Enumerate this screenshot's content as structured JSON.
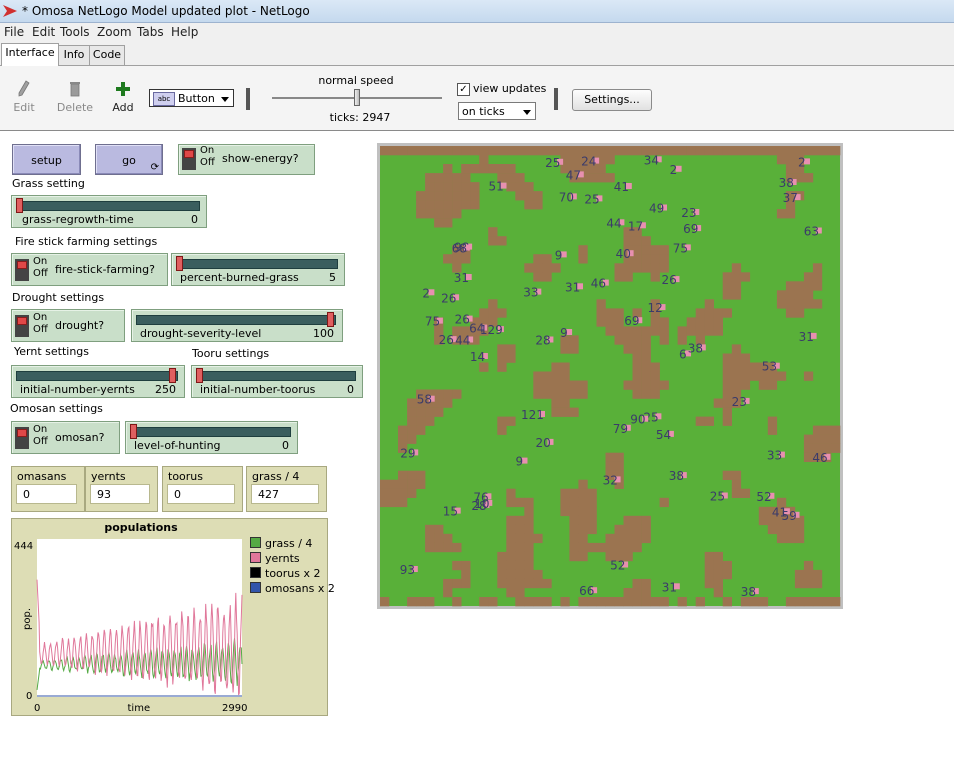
{
  "window": {
    "title": "* Omosa NetLogo Model updated plot - NetLogo"
  },
  "menu": [
    "File",
    "Edit",
    "Tools",
    "Zoom",
    "Tabs",
    "Help"
  ],
  "tabs": [
    "Interface",
    "Info",
    "Code"
  ],
  "toolbar": {
    "edit": "Edit",
    "delete": "Delete",
    "add": "Add",
    "widget_type": "Button",
    "widget_icon": "abc",
    "speed_label": "normal speed",
    "speed_fraction": 0.5,
    "ticks": "ticks: 2947",
    "view_updates": "view updates",
    "view_updates_checked": true,
    "update_mode": "on ticks",
    "settings": "Settings..."
  },
  "buttons": {
    "setup": "setup",
    "go": "go"
  },
  "switch_text": {
    "on": "On",
    "off": "Off"
  },
  "notes": {
    "grass": "Grass setting",
    "fire": "Fire stick farming settings",
    "drought": "Drought settings",
    "yernt": "Yernt settings",
    "tooru": "Tooru settings",
    "omosan": "Omosan settings"
  },
  "switches": {
    "show_energy": "show-energy?",
    "fire_stick": "fire-stick-farming?",
    "drought": "drought?",
    "omosan": "omosan?"
  },
  "sliders": {
    "grass_regrowth": {
      "label": "grass-regrowth-time",
      "value": "0",
      "fraction": 0.0
    },
    "percent_burned": {
      "label": "percent-burned-grass",
      "value": "5",
      "fraction": 0.0
    },
    "drought_severity": {
      "label": "drought-severity-level",
      "value": "100",
      "fraction": 1.0
    },
    "yernts": {
      "label": "initial-number-yernts",
      "value": "250",
      "fraction": 1.0
    },
    "toorus": {
      "label": "initial-number-toorus",
      "value": "0",
      "fraction": 0.0
    },
    "hunting": {
      "label": "level-of-hunting",
      "value": "0",
      "fraction": 0.0
    }
  },
  "monitors": [
    {
      "label": "omasans",
      "value": "0"
    },
    {
      "label": "yernts",
      "value": "93"
    },
    {
      "label": "toorus",
      "value": "0"
    },
    {
      "label": "grass / 4",
      "value": "427"
    }
  ],
  "chart_data": {
    "type": "line",
    "title": "populations",
    "xlabel": "time",
    "ylabel": "pop.",
    "xlim": [
      0,
      2990
    ],
    "ylim": [
      0,
      444
    ],
    "x_ticks": [
      "0",
      "2990"
    ],
    "y_ticks": [
      "444",
      "0"
    ],
    "legend_placement": "right",
    "series": [
      {
        "name": "grass / 4",
        "color": "#55aa44"
      },
      {
        "name": "yernts",
        "color": "#e0779a"
      },
      {
        "name": "toorus x 2",
        "color": "#000000"
      },
      {
        "name": "omosans x 2",
        "color": "#3355aa"
      }
    ]
  },
  "world": {
    "grass_color": "#59b039",
    "dirt_color": "#9b7450",
    "labels": [
      "70",
      "15",
      "79",
      "63",
      "46",
      "25",
      "28",
      "37",
      "12",
      "31",
      "23",
      "9",
      "2",
      "24",
      "53",
      "31",
      "10",
      "2",
      "28",
      "9",
      "46",
      "52",
      "20",
      "76",
      "29",
      "9",
      "54",
      "14",
      "41",
      "25",
      "6",
      "98",
      "66",
      "38",
      "52",
      "44",
      "31",
      "33",
      "26",
      "47",
      "33",
      "49",
      "40",
      "69",
      "121",
      "26",
      "38",
      "17",
      "58",
      "41",
      "69",
      "26",
      "32",
      "93",
      "51",
      "38",
      "59",
      "31",
      "75",
      "23",
      "38",
      "25",
      "75",
      "25",
      "2",
      "64",
      "26",
      "90",
      "34",
      "44",
      "68",
      "129"
    ]
  }
}
